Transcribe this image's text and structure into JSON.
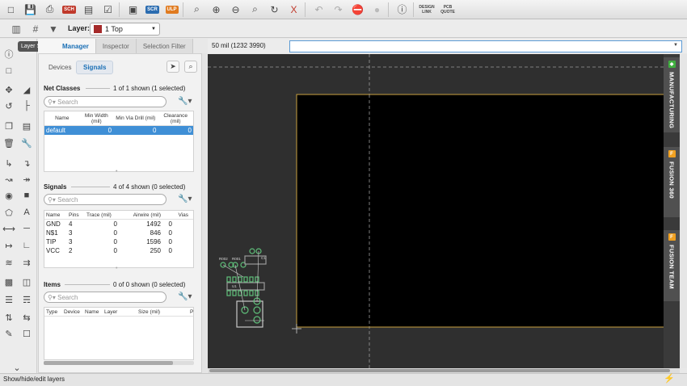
{
  "toolbar": {
    "buttons": [
      "new-file",
      "save",
      "print",
      "SCH",
      "cam",
      "sheet",
      "layers-3d",
      "SCR",
      "ULP",
      "zoom-fit",
      "zoom-in",
      "zoom-out",
      "zoom-select",
      "redraw",
      "ratsnest",
      "undo",
      "redo",
      "stop",
      "go",
      "help"
    ],
    "sch_label": "SCH",
    "scr_label": "SCR",
    "ulp_label": "ULP",
    "design_link": [
      "DESIGN",
      "LINK"
    ],
    "pcb_quote": [
      "PCB",
      "QUOTE"
    ]
  },
  "toolbar2": {
    "layer_label": "Layer:",
    "layer_value": "1 Top",
    "layer_color": "#a52a2a"
  },
  "tooltip": "Layer Settings",
  "panel": {
    "tabs": [
      "Manager",
      "Inspector",
      "Selection Filter"
    ],
    "subtabs": [
      "Devices",
      "Signals"
    ],
    "net_classes": {
      "title": "Net Classes",
      "count": "1 of 1 shown (1 selected)",
      "search_placeholder": "Search",
      "headers": [
        "Name",
        "Min Width (mil)",
        "Min Via Drill (mil)",
        "Clearance (mil)"
      ],
      "rows": [
        [
          "default",
          "0",
          "0",
          "0"
        ]
      ]
    },
    "signals": {
      "title": "Signals",
      "count": "4 of 4 shown (0 selected)",
      "search_placeholder": "Search",
      "headers": [
        "Name",
        "Pins",
        "Trace (mil)",
        "Airwire (mil)",
        "Vias"
      ],
      "rows": [
        [
          "GND",
          "4",
          "0",
          "1492",
          "0"
        ],
        [
          "N$1",
          "3",
          "0",
          "846",
          "0"
        ],
        [
          "TIP",
          "3",
          "0",
          "1596",
          "0"
        ],
        [
          "VCC",
          "2",
          "0",
          "250",
          "0"
        ]
      ]
    },
    "items": {
      "title": "Items",
      "count": "0 of 0 shown (0 selected)",
      "search_placeholder": "Search",
      "headers": [
        "Type",
        "Device",
        "Name",
        "Layer",
        "Size (mil)",
        "P"
      ]
    }
  },
  "canvas": {
    "coordinate": "50 mil (1232 3990)",
    "command_value": "",
    "board_outline_color": "#c8a040",
    "board_fill": "#000000",
    "background": "#2f2f2f",
    "part_labels": [
      "R002",
      "R001",
      "C1",
      "U1"
    ]
  },
  "right_tabs": [
    "MANUFACTURING",
    "FUSION 360",
    "FUSION TEAM"
  ],
  "status": "Show/hide/edit layers"
}
